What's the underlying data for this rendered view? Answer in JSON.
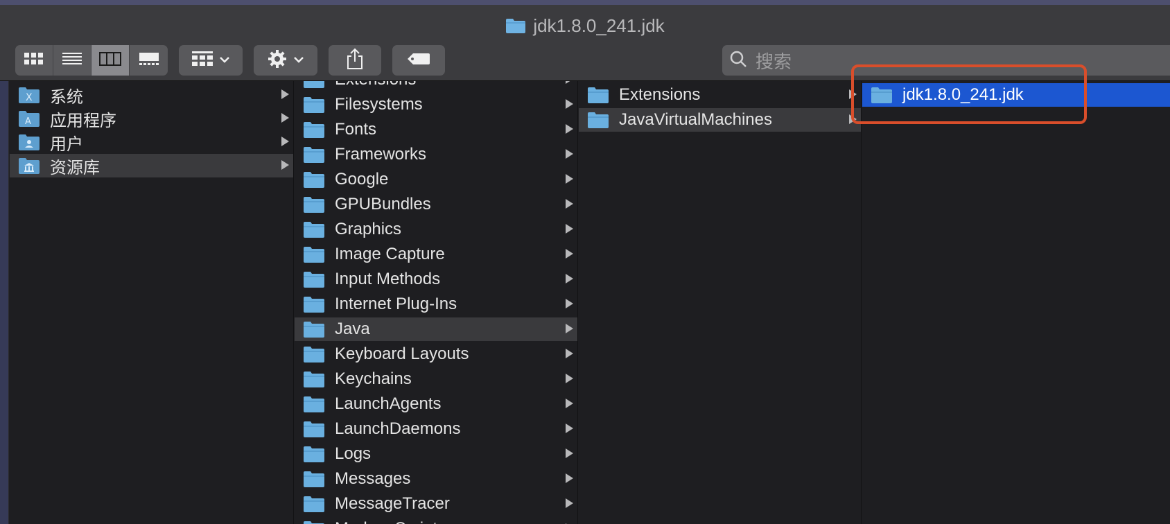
{
  "window": {
    "title": "jdk1.8.0_241.jdk"
  },
  "toolbar": {
    "view_modes": [
      {
        "name": "icon-view-button",
        "icon": "grid-icon"
      },
      {
        "name": "list-view-button",
        "icon": "list-icon"
      },
      {
        "name": "column-view-button",
        "icon": "columns-icon",
        "active": true
      },
      {
        "name": "gallery-view-button",
        "icon": "gallery-icon"
      }
    ],
    "group_button_icon": "group-grid-icon",
    "action_button_icon": "gear-icon",
    "share_button_icon": "share-icon",
    "tag_button_icon": "tag-icon",
    "search_placeholder": "搜索"
  },
  "columns": {
    "sidebar_locations": [
      {
        "label": "系统",
        "icon": "system-folder-icon"
      },
      {
        "label": "应用程序",
        "icon": "applications-folder-icon"
      },
      {
        "label": "用户",
        "icon": "users-folder-icon"
      },
      {
        "label": "资源库",
        "icon": "library-folder-icon",
        "selected": true
      }
    ],
    "library": [
      "Extensions",
      "Filesystems",
      "Fonts",
      "Frameworks",
      "Google",
      "GPUBundles",
      "Graphics",
      "Image Capture",
      "Input Methods",
      "Internet Plug-Ins",
      "Java",
      "Keyboard Layouts",
      "Keychains",
      "LaunchAgents",
      "LaunchDaemons",
      "Logs",
      "Messages",
      "MessageTracer",
      "Modem Scripts"
    ],
    "library_selected": "Java",
    "java": [
      "Extensions",
      "JavaVirtualMachines"
    ],
    "java_selected": "JavaVirtualMachines",
    "jvms": [
      "jdk1.8.0_241.jdk"
    ],
    "jvms_selected": "jdk1.8.0_241.jdk"
  },
  "colors": {
    "selection_blue": "#1c57d1",
    "selection_gray": "#3a3a3d",
    "folder_blue": "#6ab0e0",
    "annotation_red": "#d94e2b"
  }
}
